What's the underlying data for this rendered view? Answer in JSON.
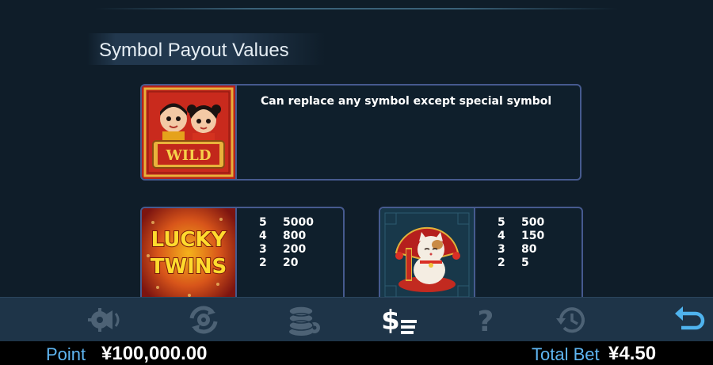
{
  "section_title": "Symbol Payout Values",
  "wild": {
    "symbol_text": "WILD",
    "description": "Can replace any symbol except special symbol"
  },
  "lucky_twins": {
    "logo_text": "LUCKY TWINS",
    "payouts": [
      {
        "count": "5",
        "value": "5000"
      },
      {
        "count": "4",
        "value": "800"
      },
      {
        "count": "3",
        "value": "200"
      },
      {
        "count": "2",
        "value": "20"
      }
    ]
  },
  "lucky_cat": {
    "payouts": [
      {
        "count": "5",
        "value": "500"
      },
      {
        "count": "4",
        "value": "150"
      },
      {
        "count": "3",
        "value": "80"
      },
      {
        "count": "2",
        "value": "5"
      }
    ]
  },
  "toolbar": {
    "icons": [
      "sound-settings-icon",
      "autoplay-settings-icon",
      "chips-settings-icon",
      "paytable-icon",
      "help-icon",
      "history-icon",
      "back-icon"
    ]
  },
  "footer": {
    "point_label": "Point",
    "point_value": "¥100,000.00",
    "total_bet_label": "Total Bet",
    "total_bet_value": "¥4.50"
  },
  "colors": {
    "background": "#0f1d29",
    "card_border": "#465a8f",
    "toolbar": "#1e3448",
    "footer_label": "#5fb6f2",
    "back_icon": "#4fb3ee"
  }
}
